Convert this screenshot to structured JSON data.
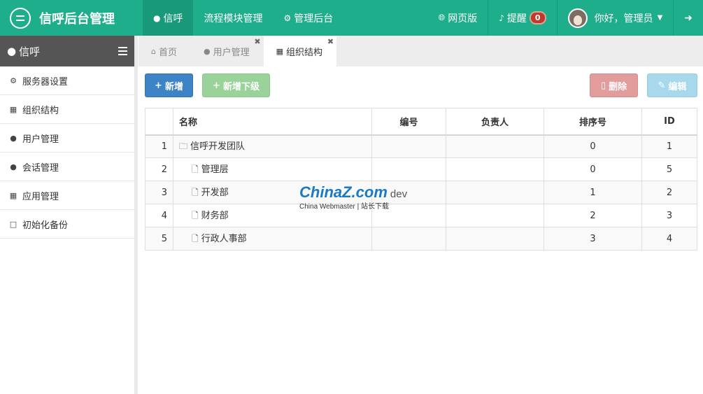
{
  "app": {
    "title": "信呼后台管理"
  },
  "topnav": {
    "items": [
      {
        "label": "信呼",
        "icon": "comment-icon"
      },
      {
        "label": "流程模块管理"
      },
      {
        "label": "管理后台",
        "icon": "gear-icon"
      }
    ],
    "web_label": "网页版",
    "remind_label": "提醒",
    "remind_count": "0",
    "user_label": "你好，管理员"
  },
  "sidebar": {
    "title": "信呼",
    "items": [
      {
        "label": "服务器设置",
        "icon": "gear-icon"
      },
      {
        "label": "组织结构",
        "icon": "sitemap-icon"
      },
      {
        "label": "用户管理",
        "icon": "user-icon"
      },
      {
        "label": "会话管理",
        "icon": "comments-icon"
      },
      {
        "label": "应用管理",
        "icon": "grid-icon"
      },
      {
        "label": "初始化备份",
        "icon": "bookmark-icon"
      }
    ]
  },
  "tabs": [
    {
      "label": "首页",
      "icon": "home-icon"
    },
    {
      "label": "用户管理",
      "icon": "user-icon"
    },
    {
      "label": "组织结构",
      "icon": "sitemap-icon",
      "active": true
    }
  ],
  "toolbar": {
    "add_label": "新增",
    "add_sub_label": "新增下级",
    "delete_label": "删除",
    "edit_label": "编辑"
  },
  "table": {
    "headers": [
      "名称",
      "编号",
      "负责人",
      "排序号",
      "ID"
    ],
    "rows": [
      {
        "index": "1",
        "name": "信呼开发团队",
        "code": "",
        "owner": "",
        "sort": "0",
        "id": "1"
      },
      {
        "index": "2",
        "name": "管理层",
        "code": "",
        "owner": "",
        "sort": "0",
        "id": "5"
      },
      {
        "index": "3",
        "name": "开发部",
        "code": "",
        "owner": "",
        "sort": "1",
        "id": "2"
      },
      {
        "index": "4",
        "name": "财务部",
        "code": "",
        "owner": "",
        "sort": "2",
        "id": "3"
      },
      {
        "index": "5",
        "name": "行政人事部",
        "code": "",
        "owner": "",
        "sort": "3",
        "id": "4"
      }
    ]
  },
  "watermark": {
    "brand": "ChinaZ.com",
    "suffix": "dev",
    "sub": "China Webmaster | 站长下载"
  },
  "colors": {
    "topbar": "#1fae8b",
    "sidebar_head": "#555555",
    "primary": "#3d84c6",
    "success": "#9ad39a",
    "danger": "#e39c9c",
    "info": "#a8d8ec"
  }
}
